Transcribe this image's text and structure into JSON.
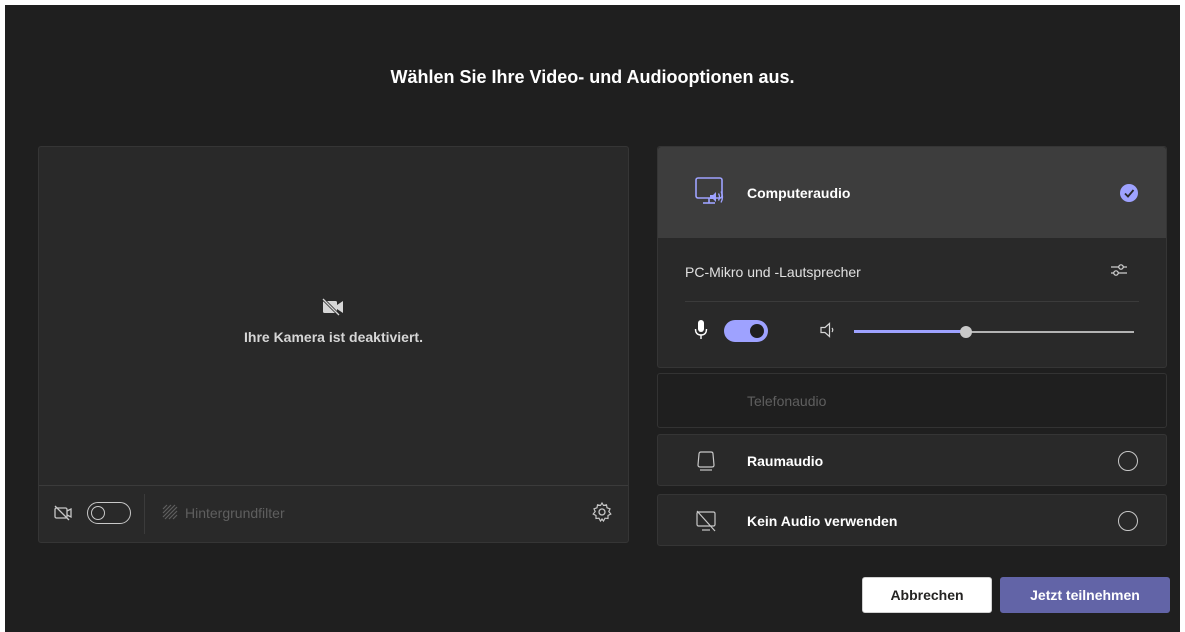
{
  "title": "Wählen Sie Ihre Video- und Audiooptionen aus.",
  "video": {
    "camera_off_text": "Ihre Kamera ist deaktiviert.",
    "camera_toggle": "off",
    "background_filter_label": "Hintergrundfilter"
  },
  "audio": {
    "computer_audio": {
      "label": "Computeraudio",
      "selected": true,
      "device_label": "PC-Mikro und -Lautsprecher",
      "mic_enabled": true,
      "speaker_volume": 0.4
    },
    "phone_audio": {
      "label": "Telefonaudio",
      "disabled": true
    },
    "room_audio": {
      "label": "Raumaudio",
      "selected": false
    },
    "no_audio": {
      "label": "Kein Audio verwenden",
      "selected": false
    }
  },
  "buttons": {
    "cancel": "Abbrechen",
    "join": "Jetzt teilnehmen"
  },
  "colors": {
    "background": "#1f1f1f",
    "panel": "#292929",
    "selected_panel": "#3d3d3d",
    "accent": "#9ea2ff",
    "join_button": "#6264a7"
  },
  "icons": [
    "camera-off-icon",
    "background-filter-icon",
    "gear-icon",
    "computer-audio-icon",
    "check-icon",
    "device-settings-icon",
    "microphone-icon",
    "speaker-icon",
    "room-audio-icon",
    "no-audio-icon"
  ]
}
